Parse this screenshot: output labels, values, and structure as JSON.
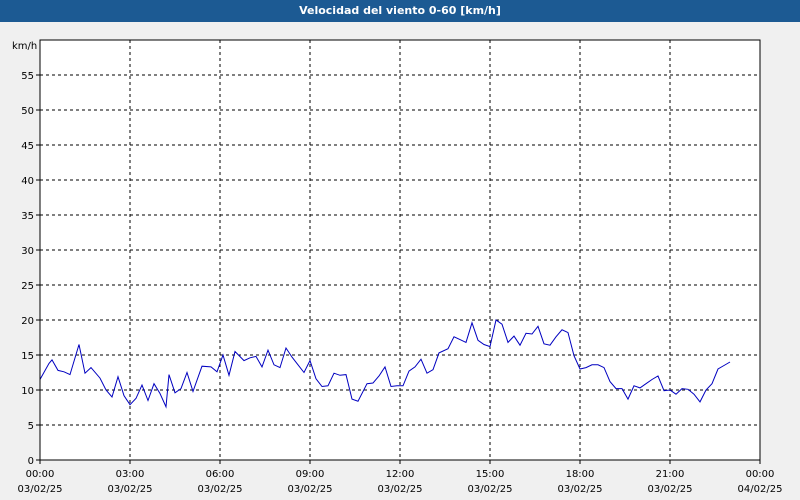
{
  "title": "Velocidad del viento 0-60 [km/h]",
  "colors": {
    "title_bg": "#1c5a93",
    "line": "#0000c0",
    "grid": "#000000",
    "plot_bg": "#ffffff"
  },
  "chart_data": {
    "type": "line",
    "title": "Velocidad del viento 0-60 [km/h]",
    "ylabel": "km/h",
    "ylim": [
      0,
      60
    ],
    "yticks": [
      0,
      5,
      10,
      15,
      20,
      25,
      30,
      35,
      40,
      45,
      50,
      55
    ],
    "xlim_hours": [
      0,
      24
    ],
    "xticks": [
      {
        "time": "00:00",
        "date": "03/02/25"
      },
      {
        "time": "03:00",
        "date": "03/02/25"
      },
      {
        "time": "06:00",
        "date": "03/02/25"
      },
      {
        "time": "09:00",
        "date": "03/02/25"
      },
      {
        "time": "12:00",
        "date": "03/02/25"
      },
      {
        "time": "15:00",
        "date": "03/02/25"
      },
      {
        "time": "18:00",
        "date": "03/02/25"
      },
      {
        "time": "21:00",
        "date": "03/02/25"
      },
      {
        "time": "00:00",
        "date": "04/02/25"
      }
    ],
    "grid": true,
    "x_hours": [
      0.0,
      0.3,
      0.4,
      0.6,
      0.8,
      1.0,
      1.3,
      1.5,
      1.7,
      2.0,
      2.2,
      2.4,
      2.6,
      2.8,
      3.0,
      3.2,
      3.4,
      3.6,
      3.8,
      4.0,
      4.2,
      4.3,
      4.5,
      4.7,
      4.9,
      5.1,
      5.4,
      5.7,
      5.9,
      6.1,
      6.3,
      6.5,
      6.8,
      7.0,
      7.2,
      7.4,
      7.6,
      7.8,
      8.0,
      8.2,
      8.4,
      8.6,
      8.8,
      9.0,
      9.2,
      9.4,
      9.6,
      9.8,
      10.0,
      10.2,
      10.4,
      10.6,
      10.9,
      11.1,
      11.3,
      11.5,
      11.7,
      11.9,
      12.1,
      12.3,
      12.5,
      12.7,
      12.9,
      13.1,
      13.3,
      13.6,
      13.8,
      14.0,
      14.2,
      14.4,
      14.6,
      14.8,
      15.0,
      15.2,
      15.4,
      15.6,
      15.8,
      16.0,
      16.2,
      16.4,
      16.6,
      16.8,
      17.0,
      17.2,
      17.4,
      17.6,
      17.8,
      18.0,
      18.2,
      18.4,
      18.6,
      18.8,
      19.0,
      19.2,
      19.4,
      19.6,
      19.8,
      20.0,
      20.2,
      20.4,
      20.6,
      20.8,
      21.0,
      21.2,
      21.4,
      21.6,
      21.8,
      22.0,
      22.2,
      22.4,
      22.6,
      22.8,
      23.0,
      23.2,
      23.4,
      23.6,
      23.8,
      24.0
    ],
    "series": [
      {
        "values": [
          11.5,
          13.8,
          14.3,
          12.8,
          12.6,
          12.2,
          16.5,
          12.4,
          13.2,
          11.7,
          10.0,
          9.0,
          11.9,
          9.2,
          7.9,
          8.8,
          10.7,
          8.5,
          10.9,
          9.5,
          7.6,
          12.2,
          9.6,
          10.2,
          12.5,
          9.8,
          13.4,
          13.3,
          12.6,
          15.0,
          12.1,
          15.5,
          14.2,
          14.6,
          14.8,
          13.3,
          15.7,
          13.6,
          13.2,
          16.0,
          14.7,
          13.6,
          12.5,
          14.2,
          11.6,
          10.5,
          10.6,
          12.4,
          12.1,
          12.2,
          8.7,
          8.4,
          10.9,
          11.0,
          12.0,
          13.3,
          10.5,
          10.6,
          10.6,
          12.7,
          13.3,
          14.4,
          12.4,
          12.9,
          15.3,
          15.9,
          17.6,
          17.2,
          16.8,
          19.6,
          17.1,
          16.5,
          16.2,
          20.0,
          19.4,
          16.8,
          17.7,
          16.4,
          18.1,
          18.0,
          19.1,
          16.6,
          16.4,
          17.6,
          18.6,
          18.2,
          14.9,
          13.0,
          13.2,
          13.6,
          13.6,
          13.2,
          11.2,
          10.2,
          10.2,
          8.7,
          10.6,
          10.3,
          10.9,
          11.5,
          12.0,
          9.9,
          10.0,
          9.4,
          10.2,
          10.1,
          9.4,
          8.3,
          10.0,
          10.9,
          13.0,
          13.5,
          14.0
        ]
      }
    ]
  }
}
